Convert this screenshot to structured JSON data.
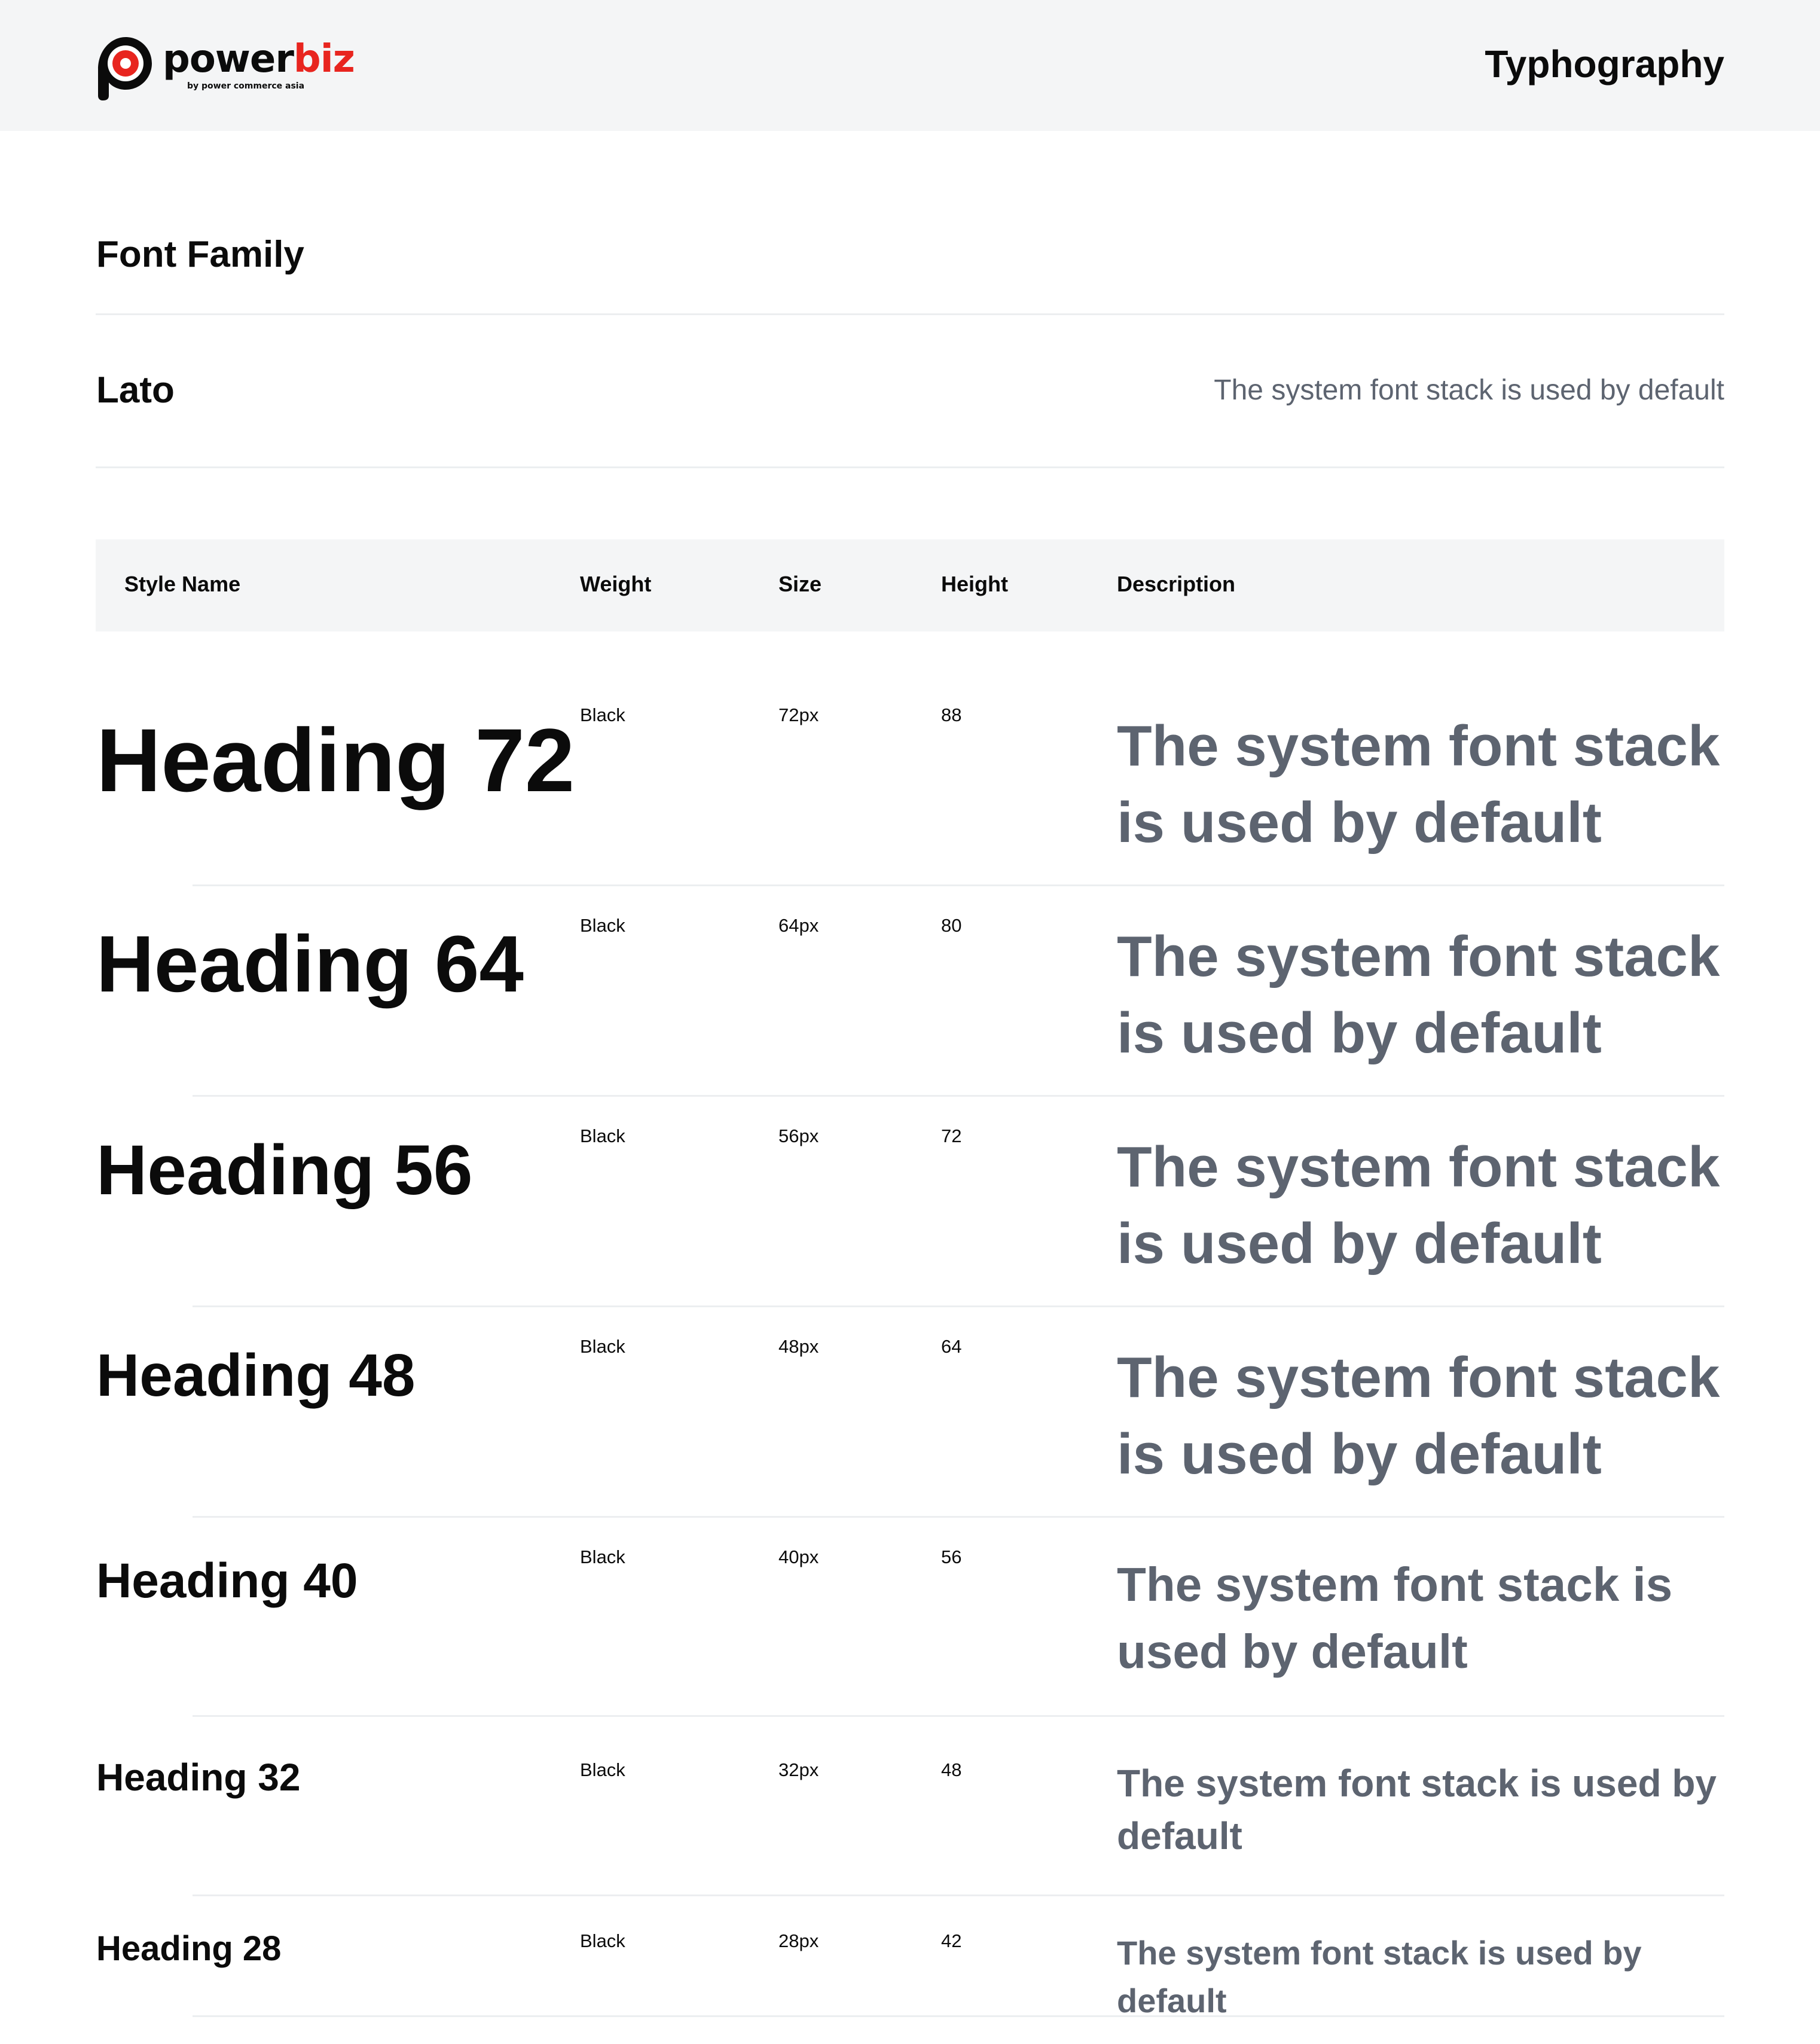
{
  "header": {
    "brand_primary": "power",
    "brand_accent": "biz",
    "brand_tagline": "by power commerce asia",
    "title": "Typhography"
  },
  "font_family": {
    "section_title": "Font Family",
    "name": "Lato",
    "description": "The system font stack is used by default"
  },
  "table": {
    "columns": [
      "Style Name",
      "Weight",
      "Size",
      "Height",
      "Description"
    ],
    "rows": [
      {
        "name": "Heading 72",
        "weight": "Black",
        "size": "72px",
        "height": "88",
        "description": "The system font stack is used by default"
      },
      {
        "name": "Heading 64",
        "weight": "Black",
        "size": "64px",
        "height": "80",
        "description": "The system font stack is used by default"
      },
      {
        "name": "Heading 56",
        "weight": "Black",
        "size": "56px",
        "height": "72",
        "description": "The system font stack is used by default"
      },
      {
        "name": "Heading 48",
        "weight": "Black",
        "size": "48px",
        "height": "64",
        "description": "The system font stack is used by default"
      },
      {
        "name": "Heading 40",
        "weight": "Black",
        "size": "40px",
        "height": "56",
        "description": "The system font stack is used by default"
      },
      {
        "name": "Heading 32",
        "weight": "Black",
        "size": "32px",
        "height": "48",
        "description": "The system font stack is used by default"
      },
      {
        "name": "Heading 28",
        "weight": "Black",
        "size": "28px",
        "height": "42",
        "description": "The system font stack is used by default"
      }
    ]
  },
  "colors": {
    "brand_red": "#e8251f",
    "text": "#0b0b0b",
    "muted": "#5d6470",
    "header_bg": "#f4f5f6",
    "divider": "#eceef0"
  }
}
